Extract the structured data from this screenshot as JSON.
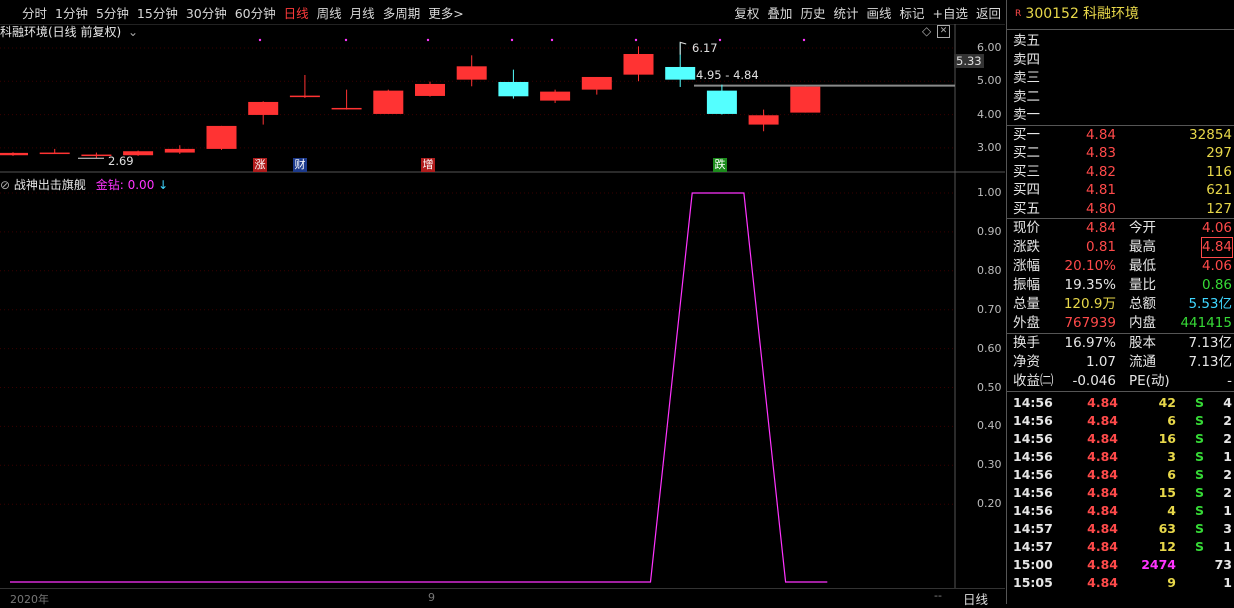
{
  "toolbar": {
    "periods": [
      "分时",
      "1分钟",
      "5分钟",
      "15分钟",
      "30分钟",
      "60分钟",
      "日线",
      "周线",
      "月线",
      "多周期",
      "更多>"
    ],
    "active_period": "日线",
    "actions": [
      "复权",
      "叠加",
      "历史",
      "统计",
      "画线",
      "标记",
      "+自选",
      "返回"
    ]
  },
  "main_chart": {
    "title": "科融环境(日线 前复权)",
    "y_ticks": [
      "6.00",
      "5.00",
      "4.00",
      "3.00"
    ],
    "current_price_tag": "5.33",
    "high_label": "6.17",
    "low_label": "2.69",
    "range_label": "4.95 - 4.84",
    "badges": [
      {
        "text": "涨",
        "color": "#b01c1c"
      },
      {
        "text": "财",
        "color": "#1c3a8c"
      },
      {
        "text": "增",
        "color": "#b01c1c"
      },
      {
        "text": "跌",
        "color": "#1c8c1c"
      }
    ],
    "candles": [
      {
        "o": 2.78,
        "c": 2.85,
        "h": 2.87,
        "l": 2.76
      },
      {
        "o": 2.86,
        "c": 2.86,
        "h": 2.97,
        "l": 2.85
      },
      {
        "o": 2.8,
        "c": 2.8,
        "h": 2.86,
        "l": 2.69
      },
      {
        "o": 2.78,
        "c": 2.9,
        "h": 2.92,
        "l": 2.76
      },
      {
        "o": 2.86,
        "c": 2.97,
        "h": 3.08,
        "l": 2.82
      },
      {
        "o": 2.97,
        "c": 3.66,
        "h": 3.66,
        "l": 2.94
      },
      {
        "o": 3.99,
        "c": 4.38,
        "h": 4.4,
        "l": 3.7
      },
      {
        "o": 4.57,
        "c": 4.57,
        "h": 5.19,
        "l": 4.5
      },
      {
        "o": 4.2,
        "c": 4.2,
        "h": 4.75,
        "l": 4.15
      },
      {
        "o": 4.02,
        "c": 4.72,
        "h": 4.75,
        "l": 4.02
      },
      {
        "o": 4.56,
        "c": 4.92,
        "h": 4.99,
        "l": 4.54
      },
      {
        "o": 5.05,
        "c": 5.45,
        "h": 5.78,
        "l": 4.85
      },
      {
        "o": 4.98,
        "c": 4.55,
        "h": 5.35,
        "l": 4.48
      },
      {
        "o": 4.42,
        "c": 4.69,
        "h": 4.75,
        "l": 4.35
      },
      {
        "o": 4.75,
        "c": 5.13,
        "h": 5.13,
        "l": 4.6
      },
      {
        "o": 5.2,
        "c": 5.82,
        "h": 6.05,
        "l": 5.0
      },
      {
        "o": 5.43,
        "c": 5.05,
        "h": 6.17,
        "l": 4.83
      },
      {
        "o": 4.72,
        "c": 4.02,
        "h": 4.9,
        "l": 4.0
      },
      {
        "o": 3.7,
        "c": 3.98,
        "h": 4.15,
        "l": 3.5
      },
      {
        "o": 4.06,
        "c": 4.84,
        "h": 4.84,
        "l": 4.06
      }
    ]
  },
  "indicator": {
    "name": "战神出击旗舰",
    "series_label": "金钻:",
    "series_value": "0.00",
    "y_ticks": [
      "1.00",
      "0.90",
      "0.80",
      "0.70",
      "0.60",
      "0.50",
      "0.40",
      "0.30",
      "0.20"
    ],
    "values": [
      0,
      0,
      0,
      0,
      0,
      0,
      0,
      0,
      0,
      0,
      0,
      0,
      0,
      0,
      0,
      0,
      1,
      1,
      0,
      0
    ]
  },
  "bottom_bar": {
    "year_label": "2020年",
    "month_label": "9",
    "period_label": "日线"
  },
  "panel": {
    "code": "300152",
    "name": "科融环境",
    "sells": [
      {
        "label": "卖五",
        "price": "",
        "vol": ""
      },
      {
        "label": "卖四",
        "price": "",
        "vol": ""
      },
      {
        "label": "卖三",
        "price": "",
        "vol": ""
      },
      {
        "label": "卖二",
        "price": "",
        "vol": ""
      },
      {
        "label": "卖一",
        "price": "",
        "vol": ""
      }
    ],
    "buys": [
      {
        "label": "买一",
        "price": "4.84",
        "vol": "32854"
      },
      {
        "label": "买二",
        "price": "4.83",
        "vol": "297"
      },
      {
        "label": "买三",
        "price": "4.82",
        "vol": "116"
      },
      {
        "label": "买四",
        "price": "4.81",
        "vol": "621"
      },
      {
        "label": "买五",
        "price": "4.80",
        "vol": "127"
      }
    ],
    "stats1": [
      {
        "l1": "现价",
        "v1": "4.84",
        "c1": "red",
        "l2": "今开",
        "v2": "4.06",
        "c2": "red"
      },
      {
        "l1": "涨跌",
        "v1": "0.81",
        "c1": "red",
        "l2": "最高",
        "v2": "4.84",
        "c2": "red"
      },
      {
        "l1": "涨幅",
        "v1": "20.10%",
        "c1": "red",
        "l2": "最低",
        "v2": "4.06",
        "c2": "red"
      },
      {
        "l1": "振幅",
        "v1": "19.35%",
        "c1": "white",
        "l2": "量比",
        "v2": "0.86",
        "c2": "green"
      },
      {
        "l1": "总量",
        "v1": "120.9万",
        "c1": "yellow",
        "l2": "总额",
        "v2": "5.53亿",
        "c2": "cyan"
      },
      {
        "l1": "外盘",
        "v1": "767939",
        "c1": "red",
        "l2": "内盘",
        "v2": "441415",
        "c2": "green"
      }
    ],
    "stats2": [
      {
        "l1": "换手",
        "v1": "16.97%",
        "l2": "股本",
        "v2": "7.13亿"
      },
      {
        "l1": "净资",
        "v1": "1.07",
        "l2": "流通",
        "v2": "7.13亿"
      },
      {
        "l1": "收益㈡",
        "v1": "-0.046",
        "l2": "PE(动)",
        "v2": "-"
      }
    ],
    "ticks": [
      {
        "t": "14:56",
        "p": "4.84",
        "v": "42",
        "s": "S",
        "n": "4",
        "vc": "yellow"
      },
      {
        "t": "14:56",
        "p": "4.84",
        "v": "6",
        "s": "S",
        "n": "2",
        "vc": "yellow"
      },
      {
        "t": "14:56",
        "p": "4.84",
        "v": "16",
        "s": "S",
        "n": "2",
        "vc": "yellow"
      },
      {
        "t": "14:56",
        "p": "4.84",
        "v": "3",
        "s": "S",
        "n": "1",
        "vc": "yellow"
      },
      {
        "t": "14:56",
        "p": "4.84",
        "v": "6",
        "s": "S",
        "n": "2",
        "vc": "yellow"
      },
      {
        "t": "14:56",
        "p": "4.84",
        "v": "15",
        "s": "S",
        "n": "2",
        "vc": "yellow"
      },
      {
        "t": "14:56",
        "p": "4.84",
        "v": "4",
        "s": "S",
        "n": "1",
        "vc": "yellow"
      },
      {
        "t": "14:57",
        "p": "4.84",
        "v": "63",
        "s": "S",
        "n": "3",
        "vc": "yellow"
      },
      {
        "t": "14:57",
        "p": "4.84",
        "v": "12",
        "s": "S",
        "n": "1",
        "vc": "yellow"
      },
      {
        "t": "15:00",
        "p": "4.84",
        "v": "2474",
        "s": "",
        "n": "73",
        "vc": "magenta"
      },
      {
        "t": "15:05",
        "p": "4.84",
        "v": "9",
        "s": "",
        "n": "1",
        "vc": "yellow"
      }
    ]
  },
  "colors": {
    "up": "#ff3333",
    "down": "#54ffff",
    "indicator": "#ff34ff",
    "grid": "#3a0000"
  }
}
